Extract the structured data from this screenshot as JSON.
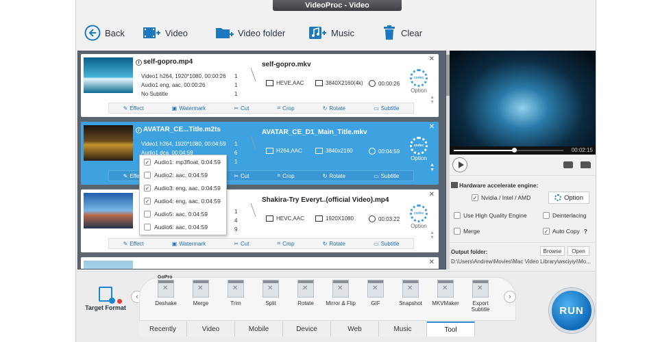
{
  "window": {
    "title": "VideoProc - Video"
  },
  "toolbar": {
    "back": "Back",
    "video": "Video",
    "video_folder": "Video folder",
    "music": "Music",
    "clear": "Clear"
  },
  "tasks": [
    {
      "src_name": "self-gopro.mp4",
      "video_line": "Video1   h264, 1920*1080, 00:00:26",
      "audio_line": "Audio1   eng, aac, 00:00:26",
      "sub_line": "No Subtitle",
      "nums": [
        "1",
        "1",
        "1"
      ],
      "out_name": "self-gopro.mkv",
      "codec": "HEVE,AAC",
      "resolution": "3840X2160(4k)",
      "duration": "00:00:26",
      "option": "Option"
    },
    {
      "src_name": "AVATAR_CE...Title.m2ts",
      "video_line": "Video1   h264, 1920*1080, 00:04:59",
      "audio_line": "Audio1   dca,  00:04:59",
      "nums": [
        "1",
        "6",
        "1"
      ],
      "out_name": "AVATAR_CE_D1_Main_Title.mkv",
      "codec": "H264,AAC",
      "resolution": "3840x2160",
      "duration": "00:04:59",
      "option": "Option"
    },
    {
      "src_name": "",
      "nums": [
        "1",
        "4",
        "9"
      ],
      "out_name": "Shakira-Try Everyt..(official Video).mp4",
      "codec": "HEVC,AAC",
      "resolution": "1920X1080",
      "duration": "00:03:22",
      "option": "Option"
    }
  ],
  "edit_bar": {
    "effect": "Effect",
    "watermark": "Watermark",
    "cut": "Cut",
    "crop": "Crop",
    "rotate": "Rotate",
    "subtitle": "Subtitle"
  },
  "audio_dropdown": [
    {
      "label": "Audio1: mp3float, 0:04:59",
      "checked": true
    },
    {
      "label": "Audio2: aac, 0:04:59",
      "checked": false
    },
    {
      "label": "Audio3: eng, aac, 0:04:59",
      "checked": true
    },
    {
      "label": "Audio4: eng, aac, 0:04:59",
      "checked": true
    },
    {
      "label": "Audio5: aac, 0:04:59",
      "checked": false
    },
    {
      "label": "Audio6: aac, 0:04:59",
      "checked": false
    }
  ],
  "preview": {
    "time": "00:02:15",
    "progress": 0.55
  },
  "settings": {
    "hw_title": "Hardware accelerate engine:",
    "nvidia": "Nvidia / Intel / AMD",
    "option": "Option",
    "high_quality": "Use High Quality Engine",
    "deinterlacing": "Deinterlacing",
    "merge": "Merge",
    "auto_copy": "Auto Copy",
    "auto_copy_help": "?",
    "output_folder": "Output folder:",
    "browse": "Browse",
    "open": "Open",
    "path": "D:\\Users\\Andrew\\Movies\\Mac Video Library\\wsciyiyi\\Mo..."
  },
  "bottom": {
    "target_format": "Target Format",
    "tools": [
      "Deshake",
      "Merge",
      "Trim",
      "Split",
      "Rotate",
      "Mirror & Flip",
      "GIF",
      "Snapshot",
      "MKVMaker",
      "Export Subtitle"
    ],
    "gopro_badge": "GoPro",
    "tabs": [
      "Recently",
      "Video",
      "Mobile",
      "Device",
      "Web",
      "Music",
      "Tool"
    ],
    "active_tab": "Tool",
    "run": "RUN"
  },
  "colors": {
    "accent": "#3ea2e0",
    "run": "#1a86d0"
  }
}
